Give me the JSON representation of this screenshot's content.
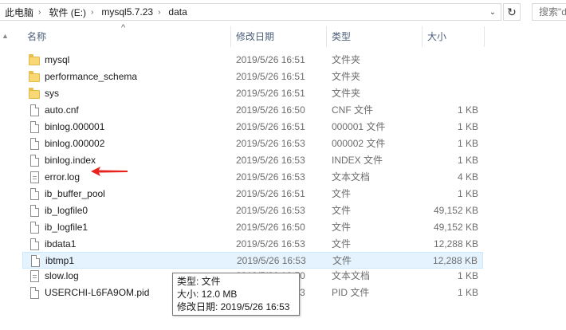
{
  "address": {
    "crumbs": [
      "此电脑",
      "软件 (E:)",
      "mysql5.7.23",
      "data"
    ],
    "search_placeholder": "搜索\"d"
  },
  "columns": {
    "name": "名称",
    "date": "修改日期",
    "type": "类型",
    "size": "大小"
  },
  "files": [
    {
      "name": "mysql",
      "date": "2019/5/26 16:51",
      "type": "文件夹",
      "size": "",
      "icon": "folder-icon"
    },
    {
      "name": "performance_schema",
      "date": "2019/5/26 16:51",
      "type": "文件夹",
      "size": "",
      "icon": "folder-icon"
    },
    {
      "name": "sys",
      "date": "2019/5/26 16:51",
      "type": "文件夹",
      "size": "",
      "icon": "folder-icon"
    },
    {
      "name": "auto.cnf",
      "date": "2019/5/26 16:50",
      "type": "CNF 文件",
      "size": "1 KB",
      "icon": "file-icon"
    },
    {
      "name": "binlog.000001",
      "date": "2019/5/26 16:51",
      "type": "000001 文件",
      "size": "1 KB",
      "icon": "file-icon"
    },
    {
      "name": "binlog.000002",
      "date": "2019/5/26 16:53",
      "type": "000002 文件",
      "size": "1 KB",
      "icon": "file-icon"
    },
    {
      "name": "binlog.index",
      "date": "2019/5/26 16:53",
      "type": "INDEX 文件",
      "size": "1 KB",
      "icon": "file-icon"
    },
    {
      "name": "error.log",
      "date": "2019/5/26 16:53",
      "type": "文本文档",
      "size": "4 KB",
      "icon": "text-file-icon"
    },
    {
      "name": "ib_buffer_pool",
      "date": "2019/5/26 16:51",
      "type": "文件",
      "size": "1 KB",
      "icon": "file-icon"
    },
    {
      "name": "ib_logfile0",
      "date": "2019/5/26 16:53",
      "type": "文件",
      "size": "49,152 KB",
      "icon": "file-icon"
    },
    {
      "name": "ib_logfile1",
      "date": "2019/5/26 16:50",
      "type": "文件",
      "size": "49,152 KB",
      "icon": "file-icon"
    },
    {
      "name": "ibdata1",
      "date": "2019/5/26 16:53",
      "type": "文件",
      "size": "12,288 KB",
      "icon": "file-icon"
    },
    {
      "name": "ibtmp1",
      "date": "2019/5/26 16:53",
      "type": "文件",
      "size": "12,288 KB",
      "icon": "file-icon",
      "selected": true
    },
    {
      "name": "slow.log",
      "date": "2019/5/26 16:50",
      "type": "文本文档",
      "size": "1 KB",
      "icon": "text-file-icon"
    },
    {
      "name": "USERCHI-L6FA9OM.pid",
      "date": "2019/5/26 16:53",
      "type": "PID 文件",
      "size": "1 KB",
      "icon": "file-icon"
    }
  ],
  "tooltip": {
    "type_line": "类型: 文件",
    "size_line": "大小: 12.0 MB",
    "date_line": "修改日期: 2019/5/26 16:53"
  },
  "colors": {
    "selected_bg": "#e5f3ff",
    "header_text": "#4c607a",
    "arrow": "#e8231d"
  }
}
